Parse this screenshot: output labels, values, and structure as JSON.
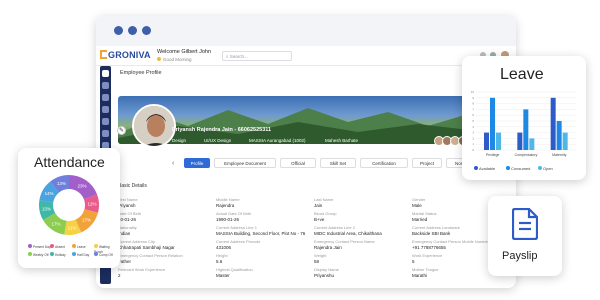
{
  "header": {
    "logo_text": "GRONIVA",
    "welcome": "Welcome Gilbert John",
    "greeting": "Good Morning",
    "search_placeholder": "Search..."
  },
  "page": {
    "title": "Employee Profile",
    "employee_name": "Priyansh Rajendra Jain - 66062525311",
    "department": "Design",
    "designation": "UI/UX Design",
    "location": "MASSIA Aurangabad (1002)",
    "manager": "Mahesh Barhate",
    "section_title": "Basic Details"
  },
  "tabs": [
    "Profile",
    "Employee Document",
    "Official",
    "Skill Set",
    "Certification",
    "Project",
    "Nominee"
  ],
  "fields": [
    {
      "label": "First Name",
      "value": "Priyansh"
    },
    {
      "label": "Middle Name",
      "value": "Rajendra"
    },
    {
      "label": "Last Name",
      "value": "Jain"
    },
    {
      "label": "Gender",
      "value": "Male"
    },
    {
      "label": "Date Of Birth",
      "value": "10-01-26"
    },
    {
      "label": "Actual Date Of Birth",
      "value": "1990-01-26"
    },
    {
      "label": "Blood Group",
      "value": "B+ve"
    },
    {
      "label": "Marital Status",
      "value": "Married"
    },
    {
      "label": "Nationality",
      "value": "Indian"
    },
    {
      "label": "Current Address Line 1",
      "value": "MASSIA Building, Second Floor, Plot No - 76"
    },
    {
      "label": "Current Address Line 2",
      "value": "MIDC Industrial Area, Chikalthana"
    },
    {
      "label": "Current Address Landmark",
      "value": "Backside SBI Bank"
    },
    {
      "label": "Current Address City",
      "value": "Chhatrapati Sambhaji Nagar"
    },
    {
      "label": "Current Address Pincode",
      "value": "431006"
    },
    {
      "label": "Emergency Contact Person Name",
      "value": "Rajendra Jain"
    },
    {
      "label": "Emergency Contact Person Mobile Number",
      "value": "+91 7788776655"
    },
    {
      "label": "Emergency Contact Person Relation",
      "value": "Father"
    },
    {
      "label": "Height",
      "value": "5.6"
    },
    {
      "label": "Weight",
      "value": "58"
    },
    {
      "label": "Work Experience",
      "value": "5"
    },
    {
      "label": "Relevant Work Experience",
      "value": "2"
    },
    {
      "label": "Highest Qualification",
      "value": "Master"
    },
    {
      "label": "Display Name",
      "value": "Priyanshu"
    },
    {
      "label": "Mother Tongue",
      "value": "Marathi"
    }
  ],
  "attendance": {
    "title": "Attendance",
    "legend": [
      "Present Days",
      "Absent",
      "Leave",
      "Waiting Punch",
      "Weekly Off",
      "Holiday",
      "Half Day",
      "Comp Off"
    ],
    "chart_data": {
      "type": "pie",
      "categories": [
        "Present Days",
        "Absent",
        "Leave",
        "Waiting Punch",
        "Weekly Off",
        "Holiday",
        "Half Day",
        "Comp Off"
      ],
      "values": [
        23,
        12,
        17,
        11,
        17,
        13,
        14,
        13
      ],
      "slice_labels": [
        "23%",
        "12%",
        "17%",
        "11%",
        "17%",
        "13%",
        "14%",
        "13%"
      ],
      "colors": [
        "#a25fc9",
        "#e85b8a",
        "#f2a23a",
        "#f5d143",
        "#8ccd4f",
        "#3fb8a7",
        "#4aa3e0",
        "#6f7fdc"
      ]
    }
  },
  "leave": {
    "title": "Leave",
    "chart_data": {
      "type": "bar",
      "categories": [
        "Privilege",
        "Compensatory",
        "Maternity"
      ],
      "series": [
        {
          "name": "Available",
          "values": [
            3,
            3,
            9
          ]
        },
        {
          "name": "Consumed",
          "values": [
            9,
            7,
            5
          ]
        },
        {
          "name": "Open",
          "values": [
            3,
            2,
            3
          ]
        }
      ],
      "ylim": [
        0,
        10
      ],
      "colors": [
        "#2d5bc9",
        "#1e88e5",
        "#4fb7e8"
      ]
    }
  },
  "payslip": {
    "title": "Payslip"
  }
}
